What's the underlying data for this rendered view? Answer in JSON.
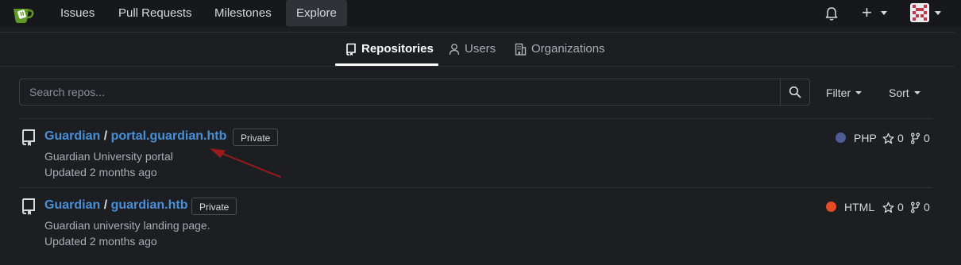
{
  "nav": {
    "items": [
      {
        "label": "Issues"
      },
      {
        "label": "Pull Requests"
      },
      {
        "label": "Milestones"
      },
      {
        "label": "Explore"
      }
    ]
  },
  "tabs": [
    {
      "label": "Repositories",
      "active": true
    },
    {
      "label": "Users",
      "active": false
    },
    {
      "label": "Organizations",
      "active": false
    }
  ],
  "search": {
    "placeholder": "Search repos...",
    "value": ""
  },
  "filter_label": "Filter",
  "sort_label": "Sort",
  "repos": [
    {
      "owner": "Guardian",
      "separator": "/",
      "name": "portal.guardian.htb",
      "badge": "Private",
      "description": "Guardian University portal",
      "updated": "Updated 2 months ago",
      "language": "PHP",
      "language_color": "#4f5d95",
      "stars": "0",
      "forks": "0"
    },
    {
      "owner": "Guardian",
      "separator": "/",
      "name": "guardian.htb",
      "badge": "Private",
      "description": "Guardian university landing page.",
      "updated": "Updated 2 months ago",
      "language": "HTML",
      "language_color": "#e34c26",
      "stars": "0",
      "forks": "0"
    }
  ],
  "colors": {
    "accent": "#4a8fd8",
    "annotation_arrow": "#9b1b1b"
  },
  "icons": {
    "logo": "gitea-logo-icon",
    "notifications": "bell-icon",
    "create": "plus-icon",
    "repo": "repo-icon",
    "user": "person-icon",
    "org": "building-icon",
    "search": "search-icon",
    "star": "star-icon",
    "fork": "fork-icon"
  }
}
